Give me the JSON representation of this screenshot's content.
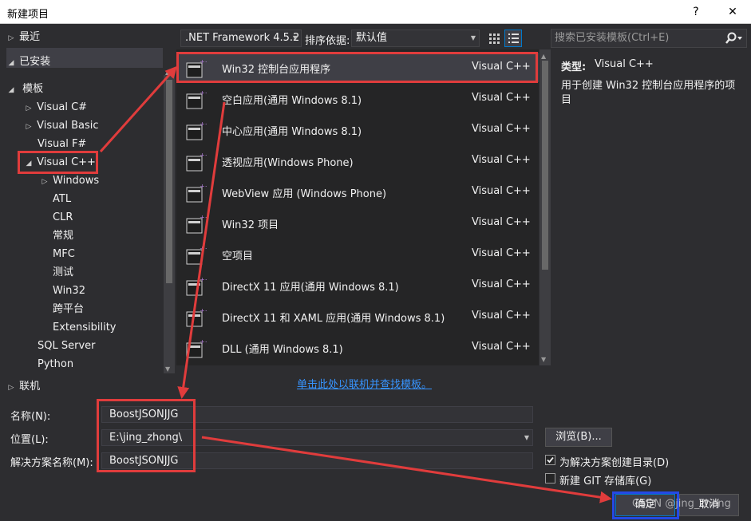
{
  "window": {
    "title": "新建项目",
    "help_glyph": "?",
    "close_glyph": "✕"
  },
  "left_tree": {
    "recent": "最近",
    "installed": "已安装",
    "templates": "模板",
    "items": [
      "Visual C#",
      "Visual Basic",
      "Visual F#",
      "Visual C++",
      "Windows",
      "ATL",
      "CLR",
      "常规",
      "MFC",
      "测试",
      "Win32",
      "跨平台",
      "Extensibility",
      "SQL Server",
      "Python"
    ],
    "online": "联机"
  },
  "toolbar": {
    "framework": ".NET Framework 4.5.2",
    "sort_label": "排序依据:",
    "sort_value": "默认值",
    "search_placeholder": "搜索已安装模板(Ctrl+E)"
  },
  "templates": [
    {
      "name": "Win32 控制台应用程序",
      "lang": "Visual C++"
    },
    {
      "name": "空白应用(通用 Windows 8.1)",
      "lang": "Visual C++"
    },
    {
      "name": "中心应用(通用 Windows 8.1)",
      "lang": "Visual C++"
    },
    {
      "name": "透视应用(Windows Phone)",
      "lang": "Visual C++"
    },
    {
      "name": "WebView 应用 (Windows Phone)",
      "lang": "Visual C++"
    },
    {
      "name": "Win32 项目",
      "lang": "Visual C++"
    },
    {
      "name": "空项目",
      "lang": "Visual C++"
    },
    {
      "name": "DirectX 11 应用(通用 Windows 8.1)",
      "lang": "Visual C++"
    },
    {
      "name": "DirectX 11 和 XAML 应用(通用 Windows 8.1)",
      "lang": "Visual C++"
    },
    {
      "name": "DLL (通用 Windows 8.1)",
      "lang": "Visual C++"
    }
  ],
  "details": {
    "type_label": "类型:",
    "type_value": "Visual C++",
    "description": "用于创建 Win32 控制台应用程序的项目"
  },
  "online_link": "单击此处以联机并查找模板。",
  "form": {
    "name_label": "名称(N):",
    "name_value": "BoostJSONJJG",
    "location_label": "位置(L):",
    "location_value": "E:\\jing_zhong\\",
    "solution_label": "解决方案名称(M):",
    "solution_value": "BoostJSONJJG",
    "browse_button": "浏览(B)...",
    "create_dir_label": "为解决方案创建目录(D)",
    "create_dir_checked": true,
    "git_label": "新建 GIT 存储库(G)",
    "git_checked": false,
    "ok_button": "确定",
    "cancel_button": "取消"
  },
  "watermark": "CSDN @jing_zhong"
}
